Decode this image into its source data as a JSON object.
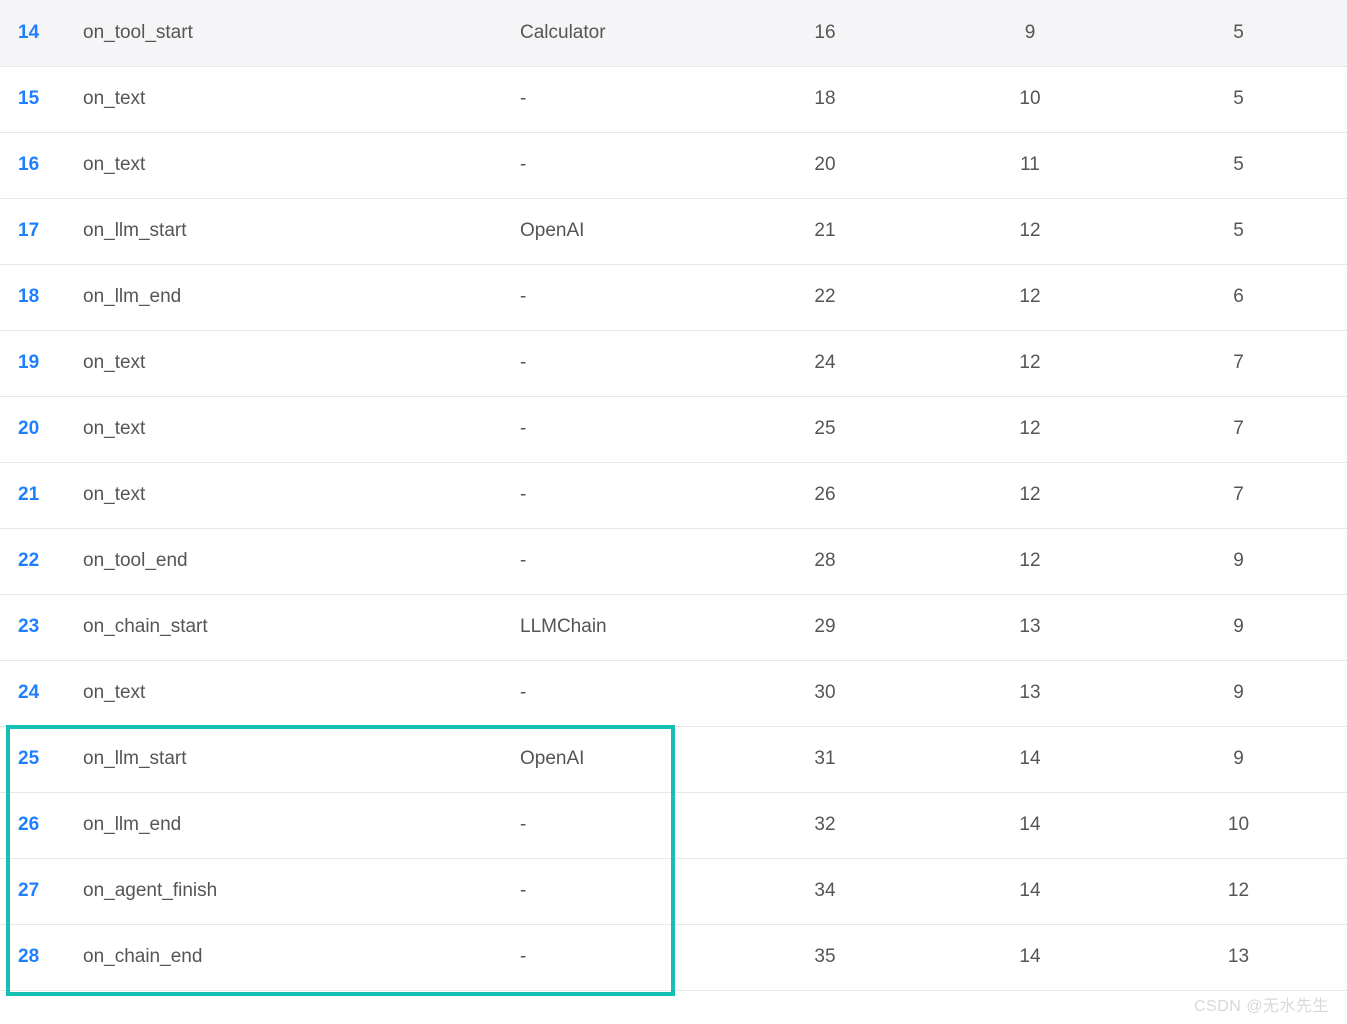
{
  "rows": [
    {
      "idx": "14",
      "event": "on_tool_start",
      "source": "Calculator",
      "c3": "16",
      "c4": "9",
      "c5": "5",
      "header": true
    },
    {
      "idx": "15",
      "event": "on_text",
      "source": "-",
      "c3": "18",
      "c4": "10",
      "c5": "5",
      "header": false
    },
    {
      "idx": "16",
      "event": "on_text",
      "source": "-",
      "c3": "20",
      "c4": "11",
      "c5": "5",
      "header": false
    },
    {
      "idx": "17",
      "event": "on_llm_start",
      "source": "OpenAI",
      "c3": "21",
      "c4": "12",
      "c5": "5",
      "header": false
    },
    {
      "idx": "18",
      "event": "on_llm_end",
      "source": "-",
      "c3": "22",
      "c4": "12",
      "c5": "6",
      "header": false
    },
    {
      "idx": "19",
      "event": "on_text",
      "source": "-",
      "c3": "24",
      "c4": "12",
      "c5": "7",
      "header": false
    },
    {
      "idx": "20",
      "event": "on_text",
      "source": "-",
      "c3": "25",
      "c4": "12",
      "c5": "7",
      "header": false
    },
    {
      "idx": "21",
      "event": "on_text",
      "source": "-",
      "c3": "26",
      "c4": "12",
      "c5": "7",
      "header": false
    },
    {
      "idx": "22",
      "event": "on_tool_end",
      "source": "-",
      "c3": "28",
      "c4": "12",
      "c5": "9",
      "header": false
    },
    {
      "idx": "23",
      "event": "on_chain_start",
      "source": "LLMChain",
      "c3": "29",
      "c4": "13",
      "c5": "9",
      "header": false
    },
    {
      "idx": "24",
      "event": "on_text",
      "source": "-",
      "c3": "30",
      "c4": "13",
      "c5": "9",
      "header": false
    },
    {
      "idx": "25",
      "event": "on_llm_start",
      "source": "OpenAI",
      "c3": "31",
      "c4": "14",
      "c5": "9",
      "header": false
    },
    {
      "idx": "26",
      "event": "on_llm_end",
      "source": "-",
      "c3": "32",
      "c4": "14",
      "c5": "10",
      "header": false
    },
    {
      "idx": "27",
      "event": "on_agent_finish",
      "source": "-",
      "c3": "34",
      "c4": "14",
      "c5": "12",
      "header": false
    },
    {
      "idx": "28",
      "event": "on_chain_end",
      "source": "-",
      "c3": "35",
      "c4": "14",
      "c5": "13",
      "header": false
    }
  ],
  "watermark": "CSDN @无水先生"
}
